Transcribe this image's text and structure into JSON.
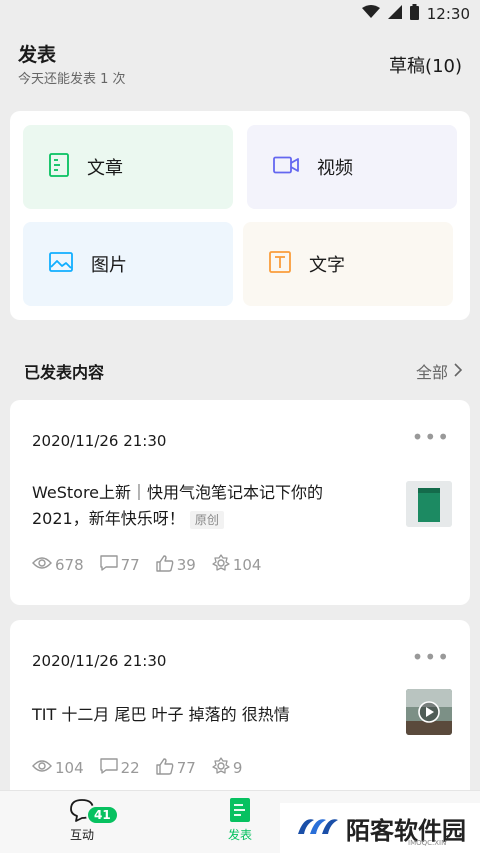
{
  "status_bar": {
    "time": "12:30",
    "icons": [
      "wifi-icon",
      "signal-icon",
      "battery-icon"
    ]
  },
  "header": {
    "title": "发表",
    "subtitle": "今天还能发表 1 次",
    "drafts": "草稿(10)"
  },
  "publish_options": {
    "article": {
      "label": "文章",
      "icon": "article-icon",
      "color": "#07c160"
    },
    "video": {
      "label": "视频",
      "icon": "video-icon",
      "color": "#6467f0"
    },
    "image": {
      "label": "图片",
      "icon": "image-icon",
      "color": "#10aeff"
    },
    "text": {
      "label": "文字",
      "icon": "text-icon",
      "color": "#fa9d3b"
    }
  },
  "published": {
    "title": "已发表内容",
    "all_label": "全部",
    "posts": [
      {
        "date": "2020/11/26 21:30",
        "text": "WeStore上新｜快用气泡笔记本记下你的 2021，新年快乐呀！",
        "tag": "原创",
        "stats": {
          "views": "678",
          "comments": "77",
          "likes": "39",
          "shares": "104"
        }
      },
      {
        "date": "2020/11/26 21:30",
        "text": "TIT 十二月 尾巴 叶子 掉落的 很热情",
        "stats": {
          "views": "104",
          "comments": "22",
          "likes": "77",
          "shares": "9"
        }
      }
    ]
  },
  "tabbar": {
    "interact": {
      "label": "互动",
      "badge": "41"
    },
    "publish": {
      "label": "发表"
    }
  },
  "watermark": {
    "text": "陌客软件园",
    "sub": "IMOQC.XIN"
  },
  "colors": {
    "accent": "#07c160",
    "background": "#ededed"
  }
}
